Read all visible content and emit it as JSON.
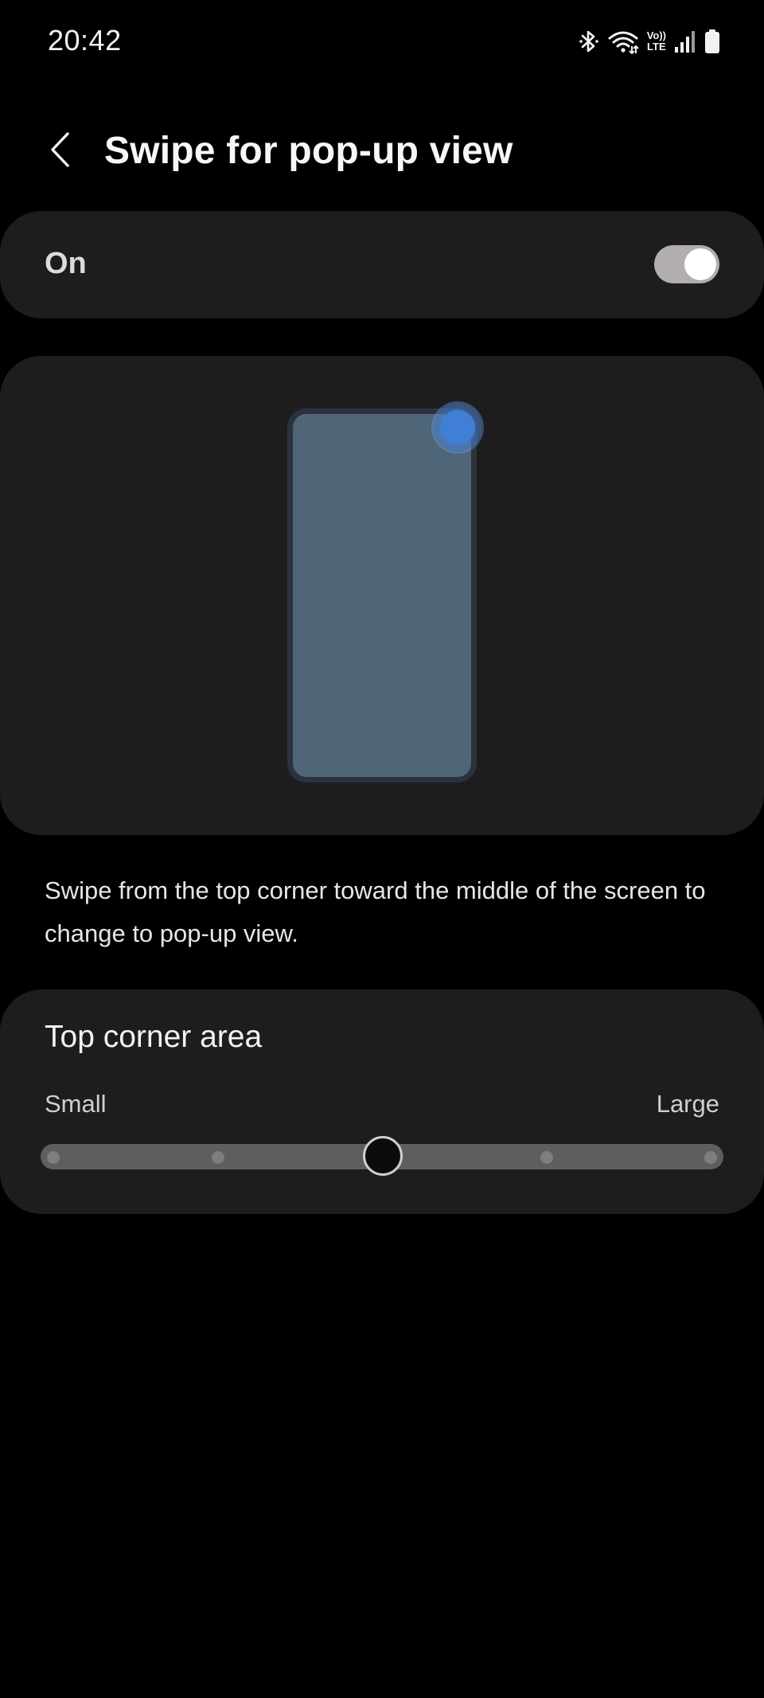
{
  "status_bar": {
    "time": "20:42",
    "icons": [
      "bluetooth-icon",
      "wifi-icon",
      "volte-icon",
      "signal-icon",
      "battery-icon"
    ],
    "volte_top": "Vo))",
    "volte_bottom": "LTE"
  },
  "header": {
    "back_icon": "chevron-left-icon",
    "title": "Swipe for pop-up view"
  },
  "toggle": {
    "label": "On",
    "state": true
  },
  "preview": {
    "illustration": "phone-with-top-corner-touch"
  },
  "description": "Swipe from the top corner toward the middle of the screen to change to pop-up view.",
  "corner_area": {
    "title": "Top corner area",
    "min_label": "Small",
    "max_label": "Large",
    "steps": 5,
    "selected_step": 3
  },
  "colors": {
    "background": "#000000",
    "card": "#1d1d1d",
    "toggle_track": "#b3aeae",
    "phone_screen": "#4f6578",
    "touch_indicator": "#3f7fd6",
    "slider_track": "#5e5e5e"
  }
}
